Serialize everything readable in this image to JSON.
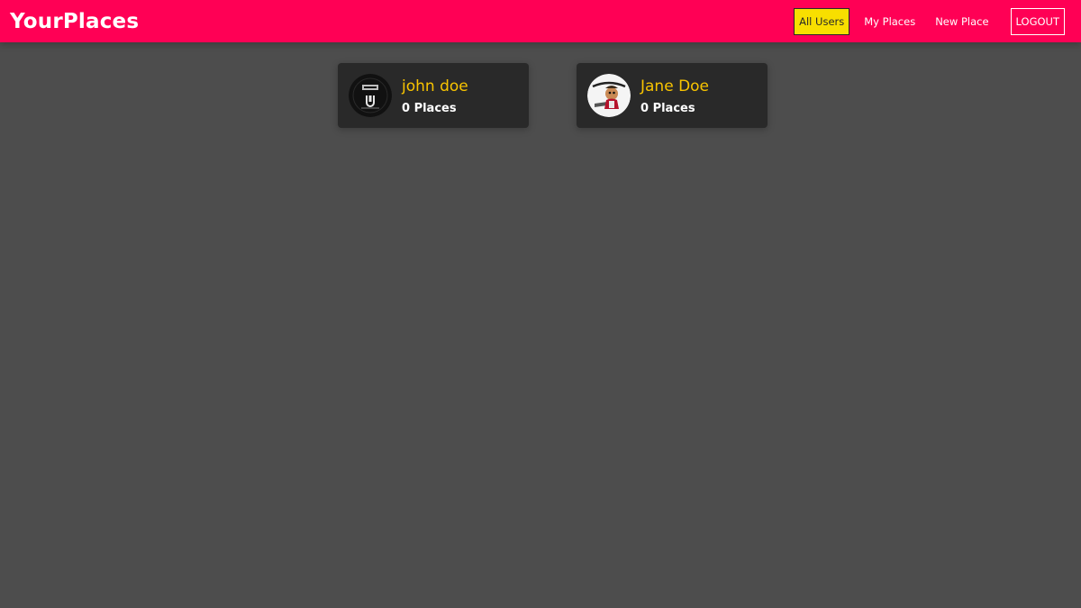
{
  "header": {
    "logo": "YourPlaces",
    "brand_color": "#ff0055",
    "nav": [
      {
        "label": "All Users",
        "active": true
      },
      {
        "label": "My Places",
        "active": false
      },
      {
        "label": "New Place",
        "active": false
      },
      {
        "label": "LOGOUT",
        "active": false
      }
    ]
  },
  "users": [
    {
      "name": "john doe",
      "places": "0 Places",
      "avatar_icon": "dark-logo-avatar"
    },
    {
      "name": "Jane Doe",
      "places": "0 Places",
      "avatar_icon": "cartoon-character-avatar"
    }
  ],
  "colors": {
    "background": "#4d4d4d",
    "card": "#292929",
    "name_accent": "#f8c400",
    "active_nav": "#f8df00"
  }
}
